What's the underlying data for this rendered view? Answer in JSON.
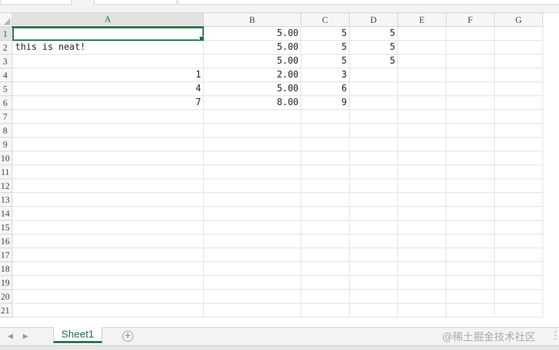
{
  "columns": [
    "A",
    "B",
    "C",
    "D",
    "E",
    "F",
    "G"
  ],
  "active_column": "A",
  "rows": [
    {
      "num": "1",
      "cells": [
        "",
        "5.00",
        "5",
        "5",
        "",
        "",
        ""
      ]
    },
    {
      "num": "2",
      "cells": [
        "this is neat!",
        "5.00",
        "5",
        "5",
        "",
        "",
        ""
      ]
    },
    {
      "num": "3",
      "cells": [
        "",
        "5.00",
        "5",
        "5",
        "",
        "",
        ""
      ]
    },
    {
      "num": "4",
      "cells": [
        "1",
        "2.00",
        "3",
        "",
        "",
        "",
        ""
      ]
    },
    {
      "num": "5",
      "cells": [
        "4",
        "5.00",
        "6",
        "",
        "",
        "",
        ""
      ]
    },
    {
      "num": "6",
      "cells": [
        "7",
        "8.00",
        "9",
        "",
        "",
        "",
        ""
      ]
    },
    {
      "num": "7",
      "cells": [
        "",
        "",
        "",
        "",
        "",
        "",
        ""
      ]
    },
    {
      "num": "8",
      "cells": [
        "",
        "",
        "",
        "",
        "",
        "",
        ""
      ]
    },
    {
      "num": "9",
      "cells": [
        "",
        "",
        "",
        "",
        "",
        "",
        ""
      ]
    },
    {
      "num": "10",
      "cells": [
        "",
        "",
        "",
        "",
        "",
        "",
        ""
      ]
    },
    {
      "num": "11",
      "cells": [
        "",
        "",
        "",
        "",
        "",
        "",
        ""
      ]
    },
    {
      "num": "12",
      "cells": [
        "",
        "",
        "",
        "",
        "",
        "",
        ""
      ]
    },
    {
      "num": "13",
      "cells": [
        "",
        "",
        "",
        "",
        "",
        "",
        ""
      ]
    },
    {
      "num": "14",
      "cells": [
        "",
        "",
        "",
        "",
        "",
        "",
        ""
      ]
    },
    {
      "num": "15",
      "cells": [
        "",
        "",
        "",
        "",
        "",
        "",
        ""
      ]
    },
    {
      "num": "16",
      "cells": [
        "",
        "",
        "",
        "",
        "",
        "",
        ""
      ]
    },
    {
      "num": "17",
      "cells": [
        "",
        "",
        "",
        "",
        "",
        "",
        ""
      ]
    },
    {
      "num": "18",
      "cells": [
        "",
        "",
        "",
        "",
        "",
        "",
        ""
      ]
    },
    {
      "num": "19",
      "cells": [
        "",
        "",
        "",
        "",
        "",
        "",
        ""
      ]
    },
    {
      "num": "20",
      "cells": [
        "",
        "",
        "",
        "",
        "",
        "",
        ""
      ]
    },
    {
      "num": "21",
      "cells": [
        "",
        "",
        "",
        "",
        "",
        "",
        ""
      ]
    }
  ],
  "sheet_tabs": {
    "active_label": "Sheet1",
    "add_icon": "plus-circle-icon",
    "prev_icon": "chevron-left-icon",
    "next_icon": "chevron-right-icon"
  },
  "watermark": "@稀土掘金技术社区",
  "colors": {
    "accent": "#217346",
    "grid_line": "#e1e1e1",
    "header_bg": "#f6f6f6"
  }
}
